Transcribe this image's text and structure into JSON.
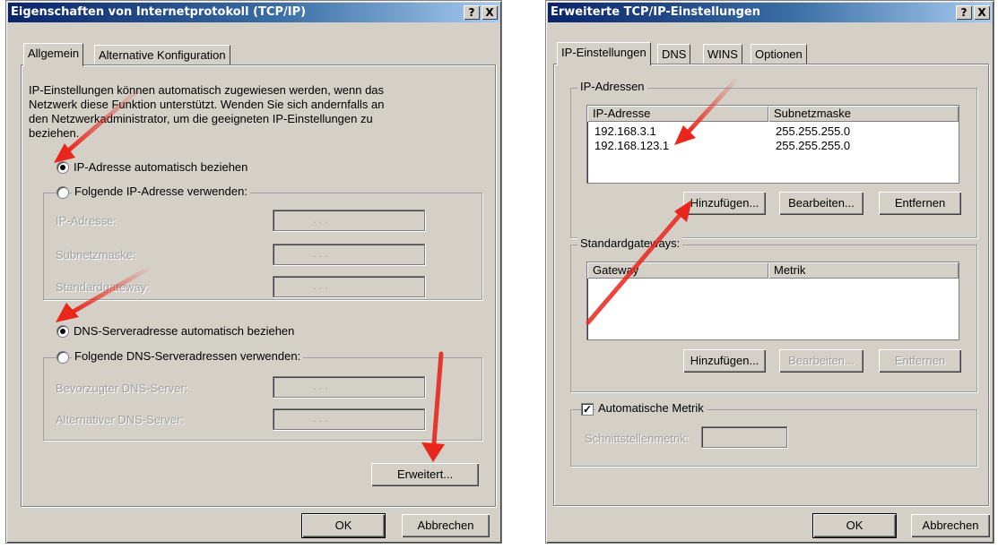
{
  "left_dialog": {
    "title": "Eigenschaften von Internetprotokoll (TCP/IP)",
    "help_btn": "?",
    "close_btn": "X",
    "tabs": [
      "Allgemein",
      "Alternative Konfiguration"
    ],
    "intro": [
      "IP-Einstellungen können automatisch zugewiesen werden, wenn das",
      "Netzwerk diese Funktion unterstützt. Wenden Sie sich andernfalls an",
      "den Netzwerkadministrator, um die geeigneten IP-Einstellungen zu",
      "beziehen."
    ],
    "radio_ip_auto": "IP-Adresse automatisch beziehen",
    "radio_ip_manual": "Folgende IP-Adresse verwenden:",
    "ip_label": "IP-Adresse:",
    "subnet_label": "Subnetzmaske:",
    "gateway_label": "Standardgateway:",
    "radio_dns_auto": "DNS-Serveradresse automatisch beziehen",
    "radio_dns_manual": "Folgende DNS-Serveradressen verwenden:",
    "dns1_label": "Bevorzugter DNS-Server:",
    "dns2_label": "Alternativer DNS-Server:",
    "ip_dots": ".   .   .",
    "advanced_btn": "Erweitert...",
    "ok_btn": "OK",
    "cancel_btn": "Abbrechen"
  },
  "right_dialog": {
    "title": "Erweiterte TCP/IP-Einstellungen",
    "help_btn": "?",
    "close_btn": "X",
    "tabs": [
      "IP-Einstellungen",
      "DNS",
      "WINS",
      "Optionen"
    ],
    "ip_group": "IP-Adressen",
    "ip_columns": [
      "IP-Adresse",
      "Subnetzmaske"
    ],
    "ip_rows": [
      {
        "ip": "192.168.3.1",
        "mask": "255.255.255.0"
      },
      {
        "ip": "192.168.123.1",
        "mask": "255.255.255.0"
      }
    ],
    "gw_group": "Standardgateways:",
    "gw_columns": [
      "Gateway",
      "Metrik"
    ],
    "add_btn": "Hinzufügen...",
    "edit_btn": "Bearbeiten...",
    "remove_btn": "Entfernen",
    "auto_metric": "Automatische Metrik",
    "interface_metric": "Schnittstellenmetrik:",
    "ok_btn": "OK",
    "cancel_btn": "Abbrechen"
  },
  "colors": {
    "dialog_bg": "#d4d0c8",
    "title_gradient_start": "#0a246a",
    "title_gradient_end": "#a6caf0",
    "arrow": "#e8261c"
  }
}
